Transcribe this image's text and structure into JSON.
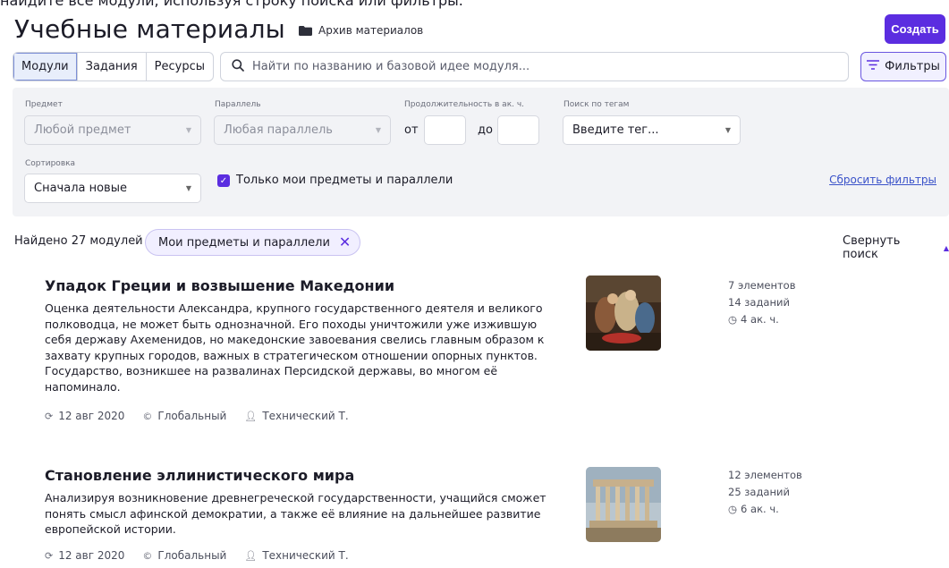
{
  "cut_text": "найдите все модули, используя строку поиска или фильтры.",
  "header": {
    "title": "Учебные материалы",
    "archive_label": "Архив материалов",
    "create_label": "Создать"
  },
  "tabs": [
    {
      "label": "Модули",
      "active": true
    },
    {
      "label": "Задания",
      "active": false
    },
    {
      "label": "Ресурсы",
      "active": false
    }
  ],
  "search": {
    "placeholder": "Найти по названию и базовой идее модуля..."
  },
  "filters_button": "Фильтры",
  "filters": {
    "subject_label": "Предмет",
    "subject_value": "Любой предмет",
    "grade_label": "Параллель",
    "grade_value": "Любая параллель",
    "duration_label": "Продолжительность в ак. ч.",
    "from_label": "от",
    "to_label": "до",
    "tags_label": "Поиск по тегам",
    "tags_placeholder": "Введите тег...",
    "sort_label": "Сортировка",
    "sort_value": "Сначала новые",
    "only_mine_label": "Только мои предметы и параллели",
    "only_mine_checked": true,
    "reset_label": "Сбросить фильтры"
  },
  "results": {
    "found_text": "Найдено 27 модулей",
    "chip_label": "Мои предметы и параллели",
    "collapse_label": "Свернуть поиск"
  },
  "modules": [
    {
      "title": "Упадок Греции и возвышение Македонии",
      "description": "Оценка деятельности Александра, крупного государственного деятеля и великого полководца, не может быть однозначной. Его походы уничтожили уже изжившую себя державу Ахеменидов, но македонские завоевания свелись главным образом к захвату крупных городов, важных в стратегическом отношении опорных пунктов. Государство, возникшее на развалинах Персидской державы, во многом её напоминало.",
      "date": "12 авг 2020",
      "scope": "Глобальный",
      "author": "Технический Т.",
      "elements": "7 элементов",
      "tasks": "14 заданий",
      "hours": "4 ак. ч."
    },
    {
      "title": "Становление эллинистического мира",
      "description": "Анализируя возникновение древнегреческой государственности, учащийся сможет понять смысл афинской демократии, а также её влияние на дальнейшее развитие европейской истории.",
      "date": "12 авг 2020",
      "scope": "Глобальный",
      "author": "Технический Т.",
      "elements": "12 элементов",
      "tasks": "25 заданий",
      "hours": "6 ак. ч."
    }
  ]
}
